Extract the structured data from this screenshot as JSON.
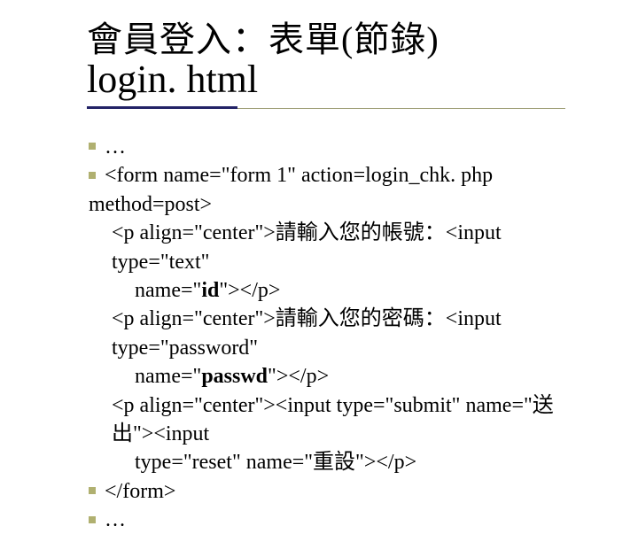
{
  "title": {
    "line1": "會員登入：表單(節錄)",
    "line2": "login. html"
  },
  "body": {
    "ellipsis_top": "…",
    "form_open": "<form name=\"form 1\" action=login_chk. php method=post>",
    "p1_a": "<p align=\"center\">請輸入您的帳號：<input type=\"text\"",
    "p1_b_prefix": "name=\"",
    "p1_b_bold": "id",
    "p1_b_suffix": "\"></p>",
    "p2_a": "<p align=\"center\">請輸入您的密碼：<input type=\"password\"",
    "p2_b_prefix": "name=\"",
    "p2_b_bold": "passwd",
    "p2_b_suffix": "\"></p>",
    "p3_a": "<p align=\"center\"><input type=\"submit\" name=\"送出\"><input",
    "p3_b": "type=\"reset\" name=\"重設\"></p>",
    "form_close": "</form>",
    "ellipsis_bottom": "…"
  }
}
